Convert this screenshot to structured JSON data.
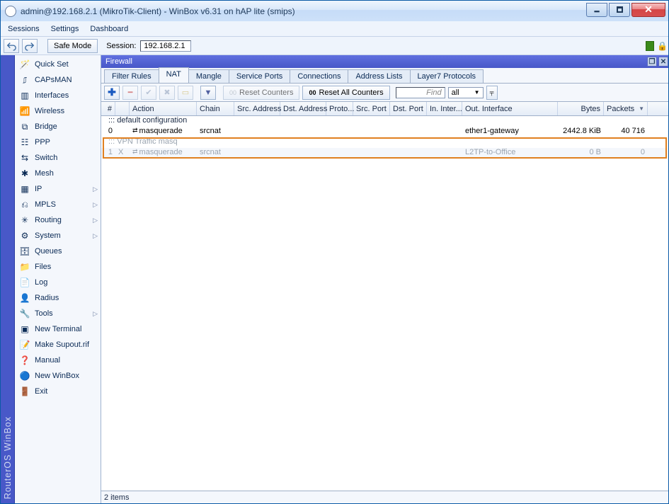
{
  "window_title": "admin@192.168.2.1 (MikroTik-Client) - WinBox v6.31 on hAP lite (smips)",
  "menubar": {
    "sessions": "Sessions",
    "settings": "Settings",
    "dashboard": "Dashboard"
  },
  "toolbar": {
    "safe_mode": "Safe Mode",
    "session_label": "Session:",
    "session_value": "192.168.2.1"
  },
  "vertical_label": "RouterOS WinBox",
  "sidebar": [
    {
      "label": "Quick Set",
      "ico": "qs",
      "expand": false
    },
    {
      "label": "CAPsMAN",
      "ico": "caps",
      "expand": false
    },
    {
      "label": "Interfaces",
      "ico": "if",
      "expand": false
    },
    {
      "label": "Wireless",
      "ico": "wl",
      "expand": false
    },
    {
      "label": "Bridge",
      "ico": "br",
      "expand": false
    },
    {
      "label": "PPP",
      "ico": "ppp",
      "expand": false
    },
    {
      "label": "Switch",
      "ico": "sw",
      "expand": false
    },
    {
      "label": "Mesh",
      "ico": "msh",
      "expand": false
    },
    {
      "label": "IP",
      "ico": "ip",
      "expand": true
    },
    {
      "label": "MPLS",
      "ico": "mpls",
      "expand": true
    },
    {
      "label": "Routing",
      "ico": "rt",
      "expand": true
    },
    {
      "label": "System",
      "ico": "sys",
      "expand": true
    },
    {
      "label": "Queues",
      "ico": "q",
      "expand": false
    },
    {
      "label": "Files",
      "ico": "fl",
      "expand": false
    },
    {
      "label": "Log",
      "ico": "log",
      "expand": false
    },
    {
      "label": "Radius",
      "ico": "rad",
      "expand": false
    },
    {
      "label": "Tools",
      "ico": "tl",
      "expand": true
    },
    {
      "label": "New Terminal",
      "ico": "nt",
      "expand": false
    },
    {
      "label": "Make Supout.rif",
      "ico": "sup",
      "expand": false
    },
    {
      "label": "Manual",
      "ico": "man",
      "expand": false
    },
    {
      "label": "New WinBox",
      "ico": "nwb",
      "expand": false
    },
    {
      "label": "Exit",
      "ico": "ex",
      "expand": false
    }
  ],
  "panel_title": "Firewall",
  "tabs": [
    {
      "label": "Filter Rules",
      "active": false
    },
    {
      "label": "NAT",
      "active": true
    },
    {
      "label": "Mangle",
      "active": false
    },
    {
      "label": "Service Ports",
      "active": false
    },
    {
      "label": "Connections",
      "active": false
    },
    {
      "label": "Address Lists",
      "active": false
    },
    {
      "label": "Layer7 Protocols",
      "active": false
    }
  ],
  "grid_toolbar": {
    "reset_counters": "Reset Counters",
    "reset_all_counters": "Reset All Counters",
    "find_placeholder": "Find",
    "filter_value": "all"
  },
  "columns": {
    "num": "#",
    "action": "Action",
    "chain": "Chain",
    "src_addr": "Src. Address",
    "dst_addr": "Dst. Address",
    "proto": "Proto...",
    "src_port": "Src. Port",
    "dst_port": "Dst. Port",
    "in_int": "In. Inter...",
    "out_int": "Out. Interface",
    "bytes": "Bytes",
    "packets": "Packets"
  },
  "rows": [
    {
      "type": "comment",
      "text": "::: default configuration"
    },
    {
      "type": "rule",
      "num": "0",
      "flag": "",
      "action": "masquerade",
      "chain": "srcnat",
      "out_int": "ether1-gateway",
      "bytes": "2442.8 KiB",
      "packets": "40 716",
      "disabled": false,
      "odd": false
    },
    {
      "type": "comment",
      "text": "::: VPN Traffic masq",
      "disabled": true
    },
    {
      "type": "rule",
      "num": "1",
      "flag": "X",
      "action": "masquerade",
      "chain": "srcnat",
      "out_int": "L2TP-to-Office",
      "bytes": "0 B",
      "packets": "0",
      "disabled": true,
      "odd": true
    }
  ],
  "status": "2 items"
}
